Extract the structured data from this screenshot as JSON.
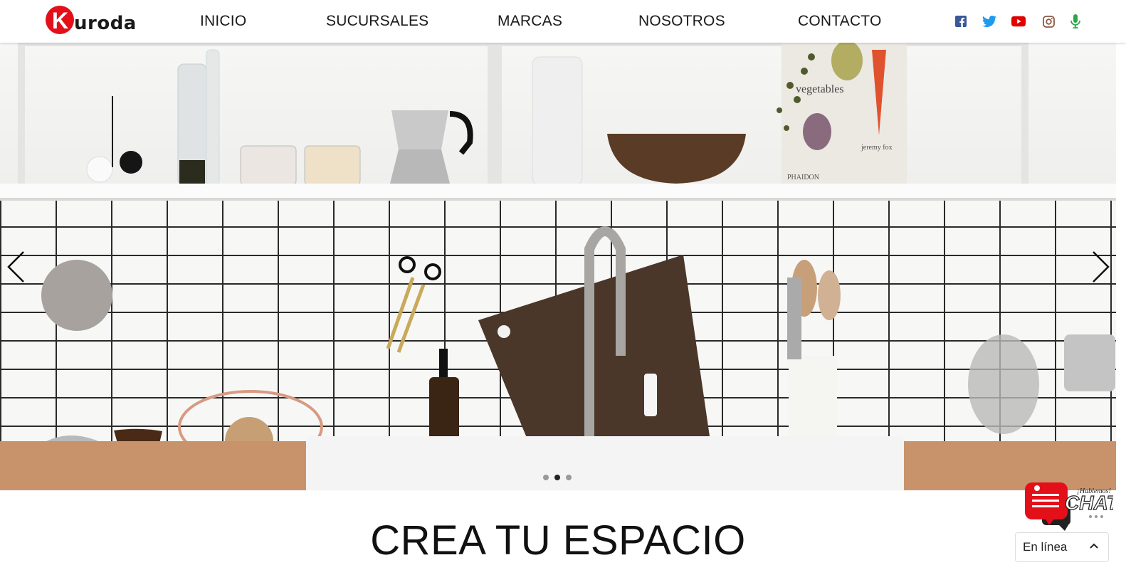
{
  "brand": {
    "name": "Kuroda",
    "logo_letter": "K",
    "logo_rest": "uroda",
    "color": "#e3101a"
  },
  "nav": [
    {
      "label": "INICIO"
    },
    {
      "label": "SUCURSALES"
    },
    {
      "label": "MARCAS"
    },
    {
      "label": "NOSOTROS"
    },
    {
      "label": "CONTACTO"
    }
  ],
  "social": [
    {
      "icon": "facebook-icon",
      "color": "#3b5998"
    },
    {
      "icon": "twitter-icon",
      "color": "#1d9bf0"
    },
    {
      "icon": "youtube-icon",
      "color": "#e00000"
    },
    {
      "icon": "instagram-icon",
      "color": "#8a5a44"
    },
    {
      "icon": "microphone-icon",
      "color": "#2aa84a"
    }
  ],
  "hero": {
    "book_title": "vegetables",
    "book_author": "jeremy fox",
    "book_publisher": "PHAIDON",
    "slides_count": 3,
    "active_slide": 2
  },
  "headline": "CREA TU ESPACIO",
  "chat": {
    "badge_top": "¡Hablemos!",
    "badge_main": "CHAT",
    "status": "En línea"
  }
}
